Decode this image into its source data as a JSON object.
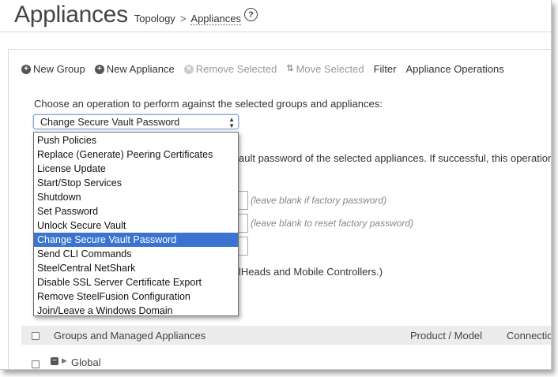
{
  "header": {
    "title": "Appliances",
    "breadcrumb": {
      "parent": "Topology",
      "separator": ">",
      "current": "Appliances"
    },
    "help_icon": "?"
  },
  "toolbar": {
    "new_group": "New Group",
    "new_appliance": "New Appliance",
    "remove_selected": "Remove Selected",
    "move_selected": "Move Selected",
    "filter": "Filter",
    "appliance_operations": "Appliance Operations"
  },
  "operation": {
    "prompt": "Choose an operation to perform against the selected groups and appliances:",
    "selected": "Change Secure Vault Password",
    "options": [
      "Push Policies",
      "Replace (Generate) Peering Certificates",
      "License Update",
      "Start/Stop Services",
      "Shutdown",
      "Set Password",
      "Unlock Secure Vault",
      "Change Secure Vault Password",
      "Send CLI Commands",
      "SteelCentral NetShark",
      "Disable SSL Server Certificate Export",
      "Remove SteelFusion Configuration",
      "Join/Leave a Windows Domain"
    ]
  },
  "background": {
    "desc_fragment": "ault password of the selected appliances. If successful, this operation",
    "hint_current": "(leave blank if factory password)",
    "hint_new": "(leave blank to reset factory password)",
    "note_fragment": "lHeads and Mobile Controllers.)"
  },
  "table": {
    "col_groups": "Groups and Managed Appliances",
    "col_product": "Product / Model",
    "col_connection": "Connection",
    "global_label": "Global"
  },
  "colors": {
    "selection": "#3a74d0",
    "header_bg": "#ececec"
  }
}
